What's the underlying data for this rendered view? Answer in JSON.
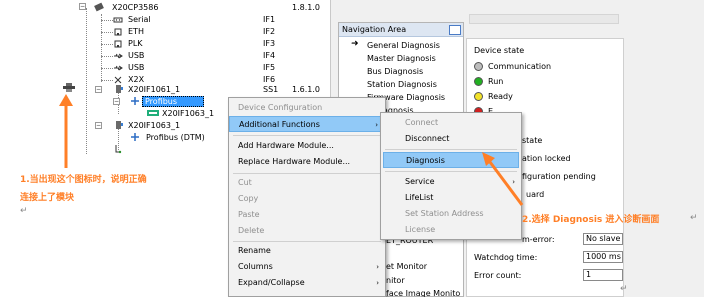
{
  "tree": {
    "root": {
      "label": "X20CP3586",
      "version": "1.8.1.0"
    },
    "interfaces": [
      {
        "label": "Serial",
        "if": "IF1"
      },
      {
        "label": "ETH",
        "if": "IF2"
      },
      {
        "label": "PLK",
        "if": "IF3"
      },
      {
        "label": "USB",
        "if": "IF4"
      },
      {
        "label": "USB",
        "if": "IF5"
      },
      {
        "label": "X2X",
        "if": "IF6"
      }
    ],
    "module1": {
      "label": "X20IF1061_1",
      "if": "SS1",
      "version": "1.6.1.0"
    },
    "profibus_selected": "Profibus (DTM)",
    "dtm_child": "X20IF1063_1",
    "module2": {
      "label": "X20IF1063_1"
    },
    "profibus2": "Profibus (DTM)"
  },
  "navigation": {
    "header": "Navigation Area",
    "items": [
      "General Diagnosis",
      "Master Diagnosis",
      "Bus Diagnosis",
      "Station Diagnosis",
      "Firmware Diagnosis",
      "d Diagnosis"
    ],
    "behind_items": [
      "ET_ROUTER",
      "et Monitor",
      "nitor",
      "face Image Monito"
    ]
  },
  "device": {
    "title": "Device state",
    "leds": [
      {
        "label": "Communication",
        "color": "#bdbdbd"
      },
      {
        "label": "Run",
        "color": "#22b022"
      },
      {
        "label": "Ready",
        "color": "#f2e22a"
      },
      {
        "label": "E",
        "color": "#d42020"
      }
    ],
    "section2": "state",
    "states": [
      "ation locked",
      "figuration pending",
      "uard"
    ],
    "fields": [
      {
        "label": "m-error:",
        "value": "No slave i"
      },
      {
        "label": "Watchdog time:",
        "value": "1000 ms"
      },
      {
        "label": "Error count:",
        "value": "1"
      }
    ]
  },
  "context_menu": {
    "items": [
      {
        "label": "Device Configuration",
        "disabled": true
      },
      {
        "label": "Additional Functions",
        "highlight": true,
        "submenu": true
      },
      {
        "label": "Add Hardware Module..."
      },
      {
        "label": "Replace Hardware Module..."
      },
      {
        "label": "Cut",
        "disabled": true
      },
      {
        "label": "Copy",
        "disabled": true
      },
      {
        "label": "Paste",
        "disabled": true
      },
      {
        "label": "Delete",
        "disabled": true
      },
      {
        "label": "Rename"
      },
      {
        "label": "Columns",
        "submenu": true
      },
      {
        "label": "Expand/Collapse",
        "submenu": true
      }
    ]
  },
  "submenu": {
    "items": [
      {
        "label": "Connect",
        "disabled": true
      },
      {
        "label": "Disconnect"
      },
      {
        "label": "Diagnosis",
        "highlight": true
      },
      {
        "label": "Service",
        "submenu": true
      },
      {
        "label": "LifeList"
      },
      {
        "label": "Set Station Address",
        "disabled": true
      },
      {
        "label": "License",
        "disabled": true
      }
    ]
  },
  "annotations": {
    "note1_line1": "1.当出现这个图标时，说明正确",
    "note1_line2": "连接上了模块",
    "note2": "2.选择 Diagnosis 进入诊断画面",
    "accent": "#ff7f27"
  }
}
